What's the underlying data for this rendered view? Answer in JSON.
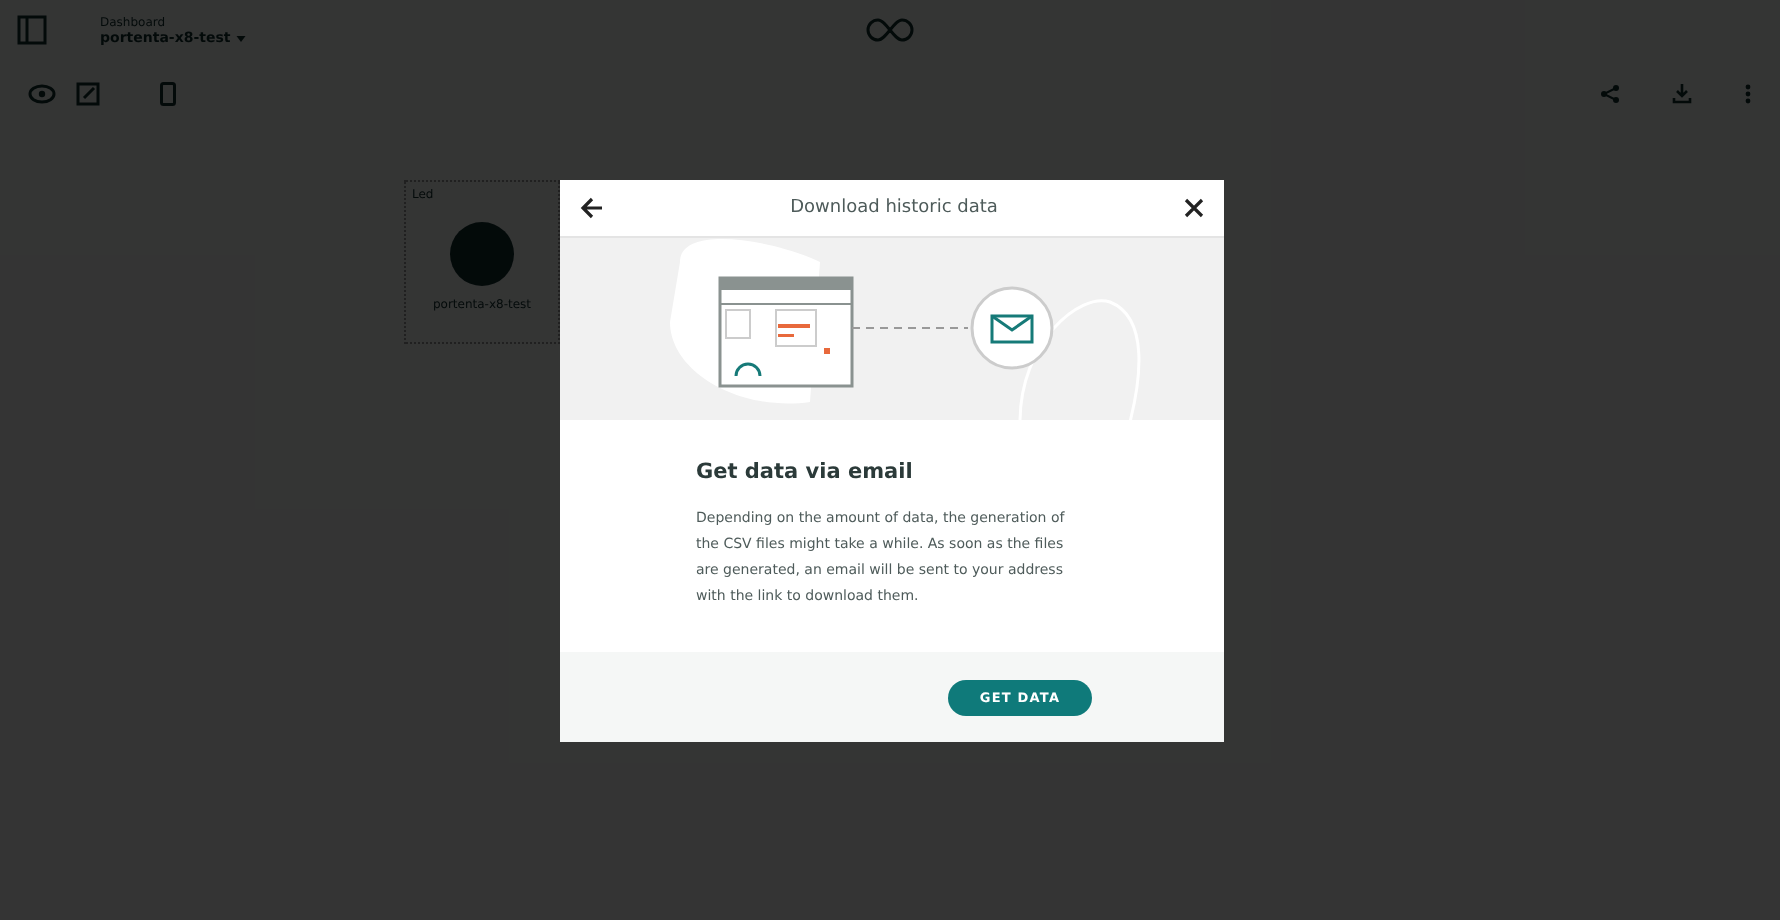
{
  "header": {
    "breadcrumb": "Dashboard",
    "thing_name": "portenta-x8-test"
  },
  "widget": {
    "title": "Led",
    "label": "portenta-x8-test"
  },
  "dialog": {
    "title": "Download historic data",
    "heading": "Get data via email",
    "body": "Depending on the amount of data, the generation of the CSV files might take a while. As soon as the files are generated, an email will be sent to your address with the link to download them.",
    "button": "GET DATA"
  }
}
